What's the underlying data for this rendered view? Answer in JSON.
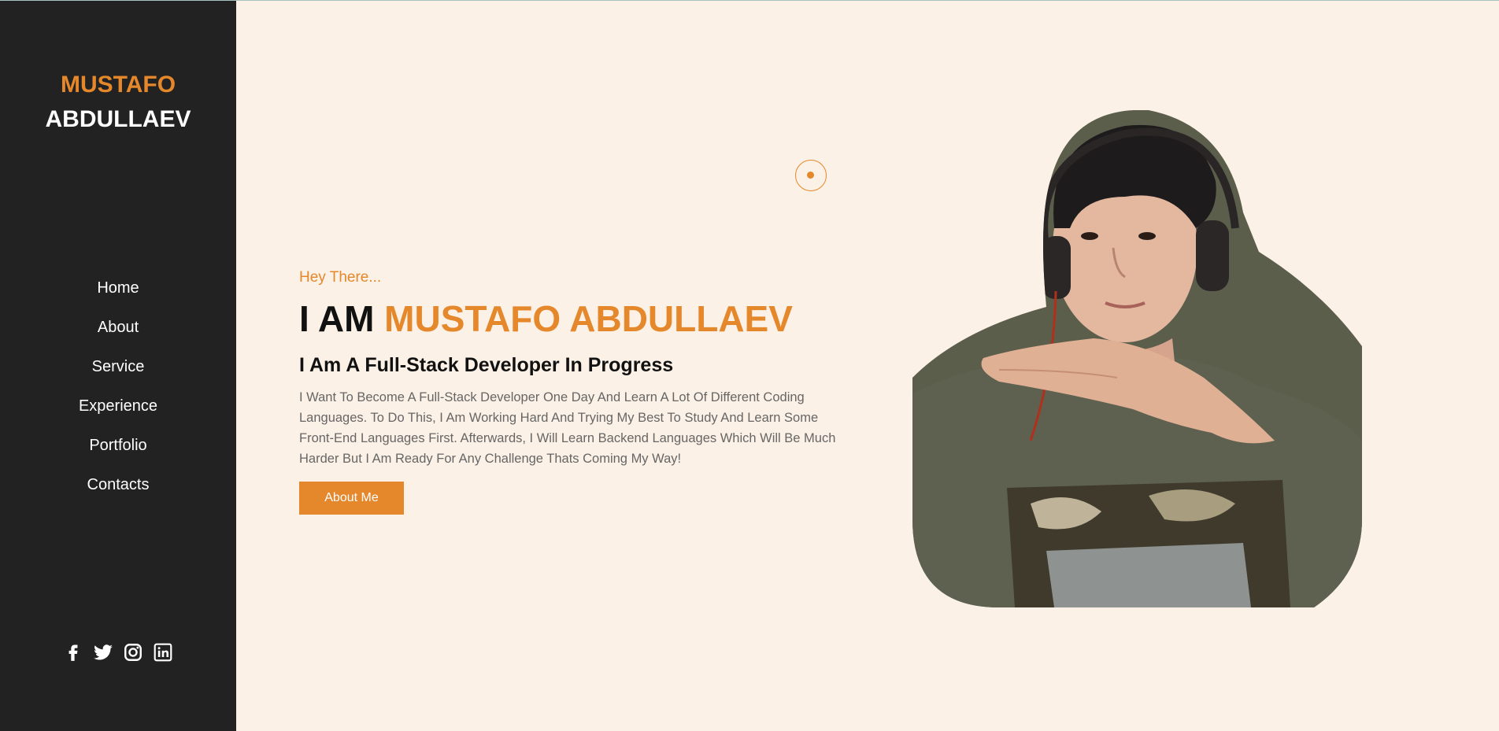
{
  "sidebar": {
    "logo_first": "MUSTAFO",
    "logo_last": "ABDULLAEV",
    "nav": [
      {
        "label": "Home"
      },
      {
        "label": "About"
      },
      {
        "label": "Service"
      },
      {
        "label": "Experience"
      },
      {
        "label": "Portfolio"
      },
      {
        "label": "Contacts"
      }
    ],
    "social_icons": [
      "facebook-icon",
      "twitter-icon",
      "instagram-icon",
      "linkedin-icon"
    ]
  },
  "hero": {
    "greeting": "Hey There...",
    "headline_prefix": "I AM ",
    "headline_name": "MUSTAFO ABDULLAEV",
    "subhead": "I Am A Full-Stack Developer In Progress",
    "description": "I Want To Become A Full-Stack Developer One Day And Learn A Lot Of Different Coding Languages. To Do This, I Am Working Hard And Trying My Best To Study And Learn Some Front-End Languages First. Afterwards, I Will Learn Backend Languages Which Will Be Much Harder But I Am Ready For Any Challenge Thats Coming My Way!",
    "button_label": "About Me"
  },
  "colors": {
    "accent": "#e5872b",
    "sidebar_bg": "#222222",
    "page_bg": "#fcf1e6"
  }
}
